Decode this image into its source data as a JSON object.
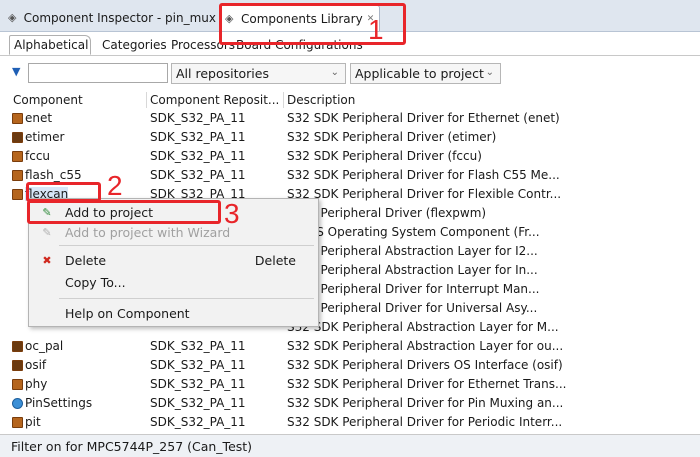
{
  "view_tabs": {
    "inspector_label": "Component Inspector - pin_mux",
    "library_label": "Components Library"
  },
  "sub_tabs": [
    "Alphabetical",
    "Categories",
    "Processors",
    "Board Configurations"
  ],
  "filter": {
    "search_value": "",
    "repository_select": "All repositories",
    "applicability_select": "Applicable to project"
  },
  "table": {
    "headers": [
      "Component",
      "Component Reposit...",
      "Description"
    ],
    "rows": [
      {
        "name": "enet",
        "repo": "SDK_S32_PA_11",
        "desc": "S32 SDK Peripheral Driver for Ethernet (enet)"
      },
      {
        "name": "etimer",
        "repo": "SDK_S32_PA_11",
        "desc": "S32 SDK Peripheral Driver (etimer)"
      },
      {
        "name": "fccu",
        "repo": "SDK_S32_PA_11",
        "desc": "S32 SDK Peripheral Driver (fccu)"
      },
      {
        "name": "flash_c55",
        "repo": "SDK_S32_PA_11",
        "desc": "S32 SDK Peripheral Driver for Flash C55 Me..."
      },
      {
        "name": "flexcan",
        "repo": "SDK_S32_PA_11",
        "desc": "S32 SDK Peripheral Driver for Flexible Contr..."
      },
      {
        "name": "",
        "repo": "",
        "desc": "SDK Peripheral Driver (flexpwm)"
      },
      {
        "name": "",
        "repo": "",
        "desc": "RTOS Operating System Component (Fr..."
      },
      {
        "name": "",
        "repo": "",
        "desc": "SDK Peripheral Abstraction Layer for I2..."
      },
      {
        "name": "",
        "repo": "",
        "desc": "SDK Peripheral Abstraction Layer for In..."
      },
      {
        "name": "",
        "repo": "",
        "desc": "SDK Peripheral Driver for Interrupt Man..."
      },
      {
        "name": "",
        "repo": "",
        "desc": "SDK Peripheral Driver for Universal Asy..."
      },
      {
        "name": "",
        "repo": "",
        "desc": "S32 SDK Peripheral Abstraction Layer for M..."
      },
      {
        "name": "oc_pal",
        "repo": "SDK_S32_PA_11",
        "desc": "S32 SDK Peripheral Abstraction Layer for ou..."
      },
      {
        "name": "osif",
        "repo": "SDK_S32_PA_11",
        "desc": "S32 SDK Peripheral Drivers OS Interface (osif)"
      },
      {
        "name": "phy",
        "repo": "SDK_S32_PA_11",
        "desc": "S32 SDK Peripheral Driver for Ethernet Trans..."
      },
      {
        "name": "PinSettings",
        "repo": "SDK_S32_PA_11",
        "desc": "S32 SDK Peripheral Driver for Pin Muxing an..."
      },
      {
        "name": "pit",
        "repo": "SDK_S32_PA_11",
        "desc": "S32 SDK Peripheral Driver for Periodic Interr..."
      }
    ]
  },
  "context_menu": {
    "add_to_project": "Add to project",
    "add_with_wizard": "Add to project with Wizard",
    "delete": "Delete",
    "delete_key": "Delete",
    "copy_to": "Copy To...",
    "help": "Help on Component"
  },
  "status_bar": "Filter on for MPC5744P_257 (Can_Test)",
  "annotations": {
    "n1": "1",
    "n2": "2",
    "n3": "3"
  },
  "colors": {
    "annotation_red": "#e8252a",
    "selection": "#d7e6f7",
    "funnel_blue": "#1f5fb5"
  },
  "icons": {
    "view_tab": "tag-icon",
    "component": "component-icon",
    "pinsettings": "pin-settings-icon",
    "filter": "funnel-icon"
  }
}
